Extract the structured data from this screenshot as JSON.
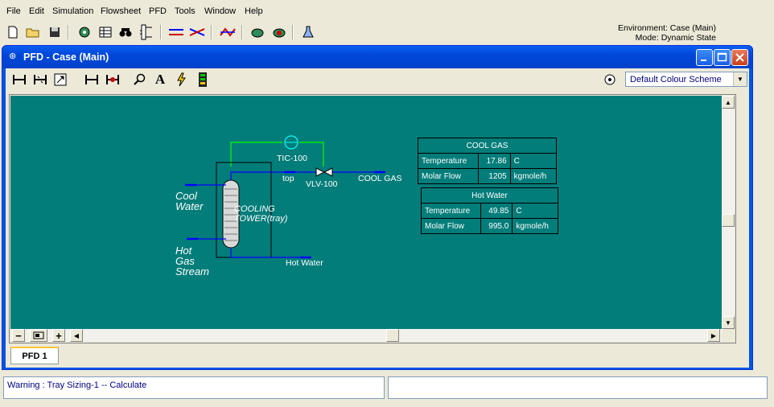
{
  "menu": [
    "File",
    "Edit",
    "Simulation",
    "Flowsheet",
    "PFD",
    "Tools",
    "Window",
    "Help"
  ],
  "environment": {
    "line1": "Environment: Case (Main)",
    "line2": "Mode: Dynamic State"
  },
  "toolbar_icons": [
    "new-icon",
    "open-icon",
    "save-icon",
    "molecule-icon",
    "workbook-icon",
    "binoculars-icon",
    "column-icon",
    "streams-icon",
    "crossover-icon",
    "pfd-icon",
    "teapot-icon",
    "record-icon",
    "flask-icon"
  ],
  "pfd_window": {
    "title": "PFD - Case (Main)",
    "colour_scheme": "Default Colour Scheme",
    "tab": "PFD 1"
  },
  "flowsheet": {
    "controller": "TIC-100",
    "valve": "VLV-100",
    "column": [
      "COOLING",
      "TOWER(tray)"
    ],
    "streams": {
      "cool_water": [
        "Cool",
        "Water"
      ],
      "hot_gas": [
        "Hot",
        "Gas",
        "Stream"
      ],
      "top": "top",
      "cool_gas": "COOL GAS",
      "hot_water": "Hot Water"
    }
  },
  "tables": [
    {
      "title": "COOL GAS",
      "rows": [
        {
          "name": "Temperature",
          "value": "17.86",
          "unit": "C"
        },
        {
          "name": "Molar Flow",
          "value": "1205",
          "unit": "kgmole/h"
        }
      ]
    },
    {
      "title": "Hot Water",
      "rows": [
        {
          "name": "Temperature",
          "value": "49.85",
          "unit": "C"
        },
        {
          "name": "Molar Flow",
          "value": "995.0",
          "unit": "kgmole/h"
        }
      ]
    }
  ],
  "status": {
    "warning": "Warning : Tray Sizing-1 -- Calculate"
  },
  "colors": {
    "canvas": "#037d7a",
    "stream": "#0000ff",
    "signal": "#00ff00"
  }
}
